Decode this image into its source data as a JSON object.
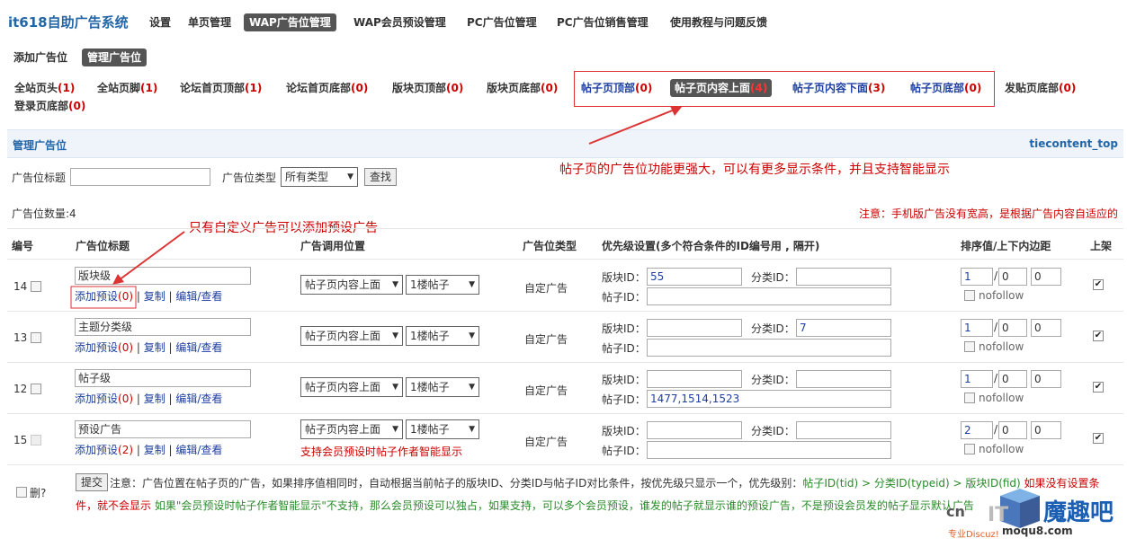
{
  "app_title": "it618自助广告系统",
  "nav": [
    "设置",
    "单页管理",
    "WAP广告位管理",
    "WAP会员预设管理",
    "PC广告位管理",
    "PC广告位销售管理",
    "使用教程与问题反馈"
  ],
  "subnav": [
    "添加广告位",
    "管理广告位"
  ],
  "positions": [
    {
      "name": "全站页头",
      "count": "(1)"
    },
    {
      "name": "全站页脚",
      "count": "(1)"
    },
    {
      "name": "论坛首页顶部",
      "count": "(1)"
    },
    {
      "name": "论坛首页底部",
      "count": "(0)"
    },
    {
      "name": "版块页顶部",
      "count": "(0)"
    },
    {
      "name": "版块页底部",
      "count": "(0)"
    },
    {
      "name": "帖子页顶部",
      "count": "(0)"
    },
    {
      "name": "帖子页内容上面",
      "count": "(4)"
    },
    {
      "name": "帖子页内容下面",
      "count": "(3)"
    },
    {
      "name": "帖子页底部",
      "count": "(0)"
    },
    {
      "name": "发贴页底部",
      "count": "(0)"
    },
    {
      "name": "登录页底部",
      "count": "(0)"
    }
  ],
  "bar": {
    "title": "管理广告位",
    "code": "tiecontent_top"
  },
  "annotations": {
    "a1": "帖子页的广告位功能更强大，可以有更多显示条件，并且支持智能显示",
    "a2": "只有自定义广告可以添加预设广告"
  },
  "filter": {
    "title_label": "广告位标题",
    "type_label": "广告位类型",
    "type_value": "所有类型",
    "search_btn": "查找"
  },
  "count_text": "广告位数量:4",
  "notice": "注意：手机版广告没有宽高，是根据广告内容自适应的",
  "headers": {
    "id": "编号",
    "title": "广告位标题",
    "call_pos": "广告调用位置",
    "type": "广告位类型",
    "priority": "优先级设置(多个符合条件的ID编号用 , 隔开)",
    "order": "排序值/上下内边距",
    "shelf": "上架"
  },
  "labels": {
    "bankuai": "版块ID：",
    "fenlei": "分类ID：",
    "tiezi": "帖子ID：",
    "nofollow": "nofollow",
    "sep": "/",
    "pipe": " | "
  },
  "rows": [
    {
      "id": "14",
      "title": "版块级",
      "preset": "添加预设",
      "preset_count": "(0)",
      "copy": "复制",
      "edit": "编辑/查看",
      "pos": "帖子页内容上面",
      "floor": "1楼帖子",
      "type": "自定广告",
      "bk": "55",
      "fl": "",
      "tz": "",
      "o1": "1",
      "o2": "0",
      "o3": "0",
      "extra": ""
    },
    {
      "id": "13",
      "title": "主题分类级",
      "preset": "添加预设",
      "preset_count": "(0)",
      "copy": "复制",
      "edit": "编辑/查看",
      "pos": "帖子页内容上面",
      "floor": "1楼帖子",
      "type": "自定广告",
      "bk": "",
      "fl": "7",
      "tz": "",
      "o1": "1",
      "o2": "0",
      "o3": "0",
      "extra": ""
    },
    {
      "id": "12",
      "title": "帖子级",
      "preset": "添加预设",
      "preset_count": "(0)",
      "copy": "复制",
      "edit": "编辑/查看",
      "pos": "帖子页内容上面",
      "floor": "1楼帖子",
      "type": "自定广告",
      "bk": "",
      "fl": "",
      "tz": "1477,1514,1523",
      "o1": "1",
      "o2": "0",
      "o3": "0",
      "extra": ""
    },
    {
      "id": "15",
      "title": "预设广告",
      "preset": "添加预设",
      "preset_count": "(2)",
      "copy": "复制",
      "edit": "编辑/查看",
      "pos": "帖子页内容上面",
      "floor": "1楼帖子",
      "type": "自定广告",
      "bk": "",
      "fl": "",
      "tz": "",
      "o1": "2",
      "o2": "0",
      "o3": "0",
      "extra": "支持会员预设时帖子作者智能显示"
    }
  ],
  "footer": {
    "del_label": "删?",
    "submit": "提交",
    "note1": "注意：广告位置在帖子页的广告，如果排序值相同时，自动根据当前帖子的版块ID、分类ID与帖子ID对比条件，按优先级只显示一个，优先级别：",
    "note1_green": "帖子ID(tid) > 分类ID(typeid) > 版块ID(fid)",
    "note1_red": " 如果没有设置条",
    "note2_red": "件，就不会显示",
    "note2_green": " 如果\"会员预设时帖子作者智能显示\"不支持，那么会员预设可以独占，如果支持，可以多个会员预设，谁发的帖子就显示谁的预设广告，不是预设会员发的帖子显示默认广告"
  },
  "watermark": {
    "brand": "魔趣吧",
    "site": "moqu8.com",
    "sub": "专业Discuz!"
  }
}
